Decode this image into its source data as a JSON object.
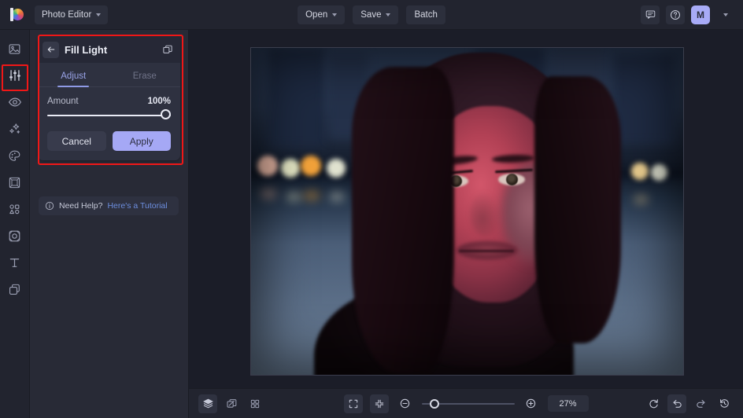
{
  "topbar": {
    "logo_icon": "brand-logo-icon",
    "app_menu_label": "Photo Editor",
    "open_label": "Open",
    "save_label": "Save",
    "batch_label": "Batch",
    "feedback_icon": "chat-bubble-icon",
    "help_icon": "question-circle-icon",
    "avatar_initial": "M",
    "avatar_chevron_icon": "chevron-down-icon"
  },
  "rail": {
    "items": [
      {
        "icon": "image-crop-icon",
        "active": false
      },
      {
        "icon": "adjust-sliders-icon",
        "active": true
      },
      {
        "icon": "retouch-eye-icon",
        "active": false
      },
      {
        "icon": "effects-sparkle-icon",
        "active": false
      },
      {
        "icon": "color-palette-icon",
        "active": false
      },
      {
        "icon": "frame-border-icon",
        "active": false
      },
      {
        "icon": "elements-shapes-icon",
        "active": false
      },
      {
        "icon": "mask-overlay-icon",
        "active": false
      },
      {
        "icon": "text-tool-icon",
        "active": false
      },
      {
        "icon": "layers-duplicate-icon",
        "active": false
      }
    ]
  },
  "panel": {
    "back_icon": "back-arrow-icon",
    "title": "Fill Light",
    "duplicate_icon": "duplicate-layer-icon",
    "tabs": [
      {
        "label": "Adjust",
        "active": true
      },
      {
        "label": "Erase",
        "active": false
      }
    ],
    "slider": {
      "label": "Amount",
      "value_text": "100%",
      "value": 100,
      "min": 0,
      "max": 100
    },
    "cancel_label": "Cancel",
    "apply_label": "Apply",
    "apply_color": "#a5a8f5"
  },
  "help": {
    "info_icon": "info-circle-icon",
    "text": "Need Help?",
    "link_text": "Here's a Tutorial",
    "link_color": "#6d8fe0"
  },
  "canvas": {
    "image_alt": "Portrait of a smiling woman at dusk with bokeh city lights",
    "highlight_color": "#f01717"
  },
  "bottombar": {
    "layers_icon": "layers-stack-icon",
    "duplicate_icon": "duplicate-canvas-icon",
    "grid_icon": "grid-view-icon",
    "fit_screen_icon": "fit-to-screen-icon",
    "actual_size_icon": "collapse-arrows-icon",
    "zoom_out_icon": "zoom-out-icon",
    "zoom_in_icon": "zoom-in-icon",
    "zoom_level": "27%",
    "zoom_slider_percent": 12,
    "reset_icon": "reset-rotate-icon",
    "undo_icon": "undo-icon",
    "redo_icon": "redo-icon",
    "history_icon": "history-clock-icon"
  }
}
